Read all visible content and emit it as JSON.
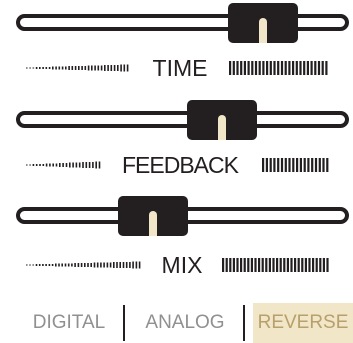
{
  "sliders": [
    {
      "id": "time",
      "label": "TIME",
      "level": 0.74
    },
    {
      "id": "feedback",
      "label": "FEEDBACK",
      "level": 0.62
    },
    {
      "id": "mix",
      "label": "MIX",
      "level": 0.41
    }
  ],
  "modes": [
    {
      "label": "DIGITAL",
      "active": false
    },
    {
      "label": "ANALOG",
      "active": false
    },
    {
      "label": "REVERSE",
      "active": true
    }
  ],
  "colors": {
    "ink": "#231f20",
    "thumb_indicator": "#f1e6c8",
    "active_mode_bg": "#f2e6c8",
    "active_mode_text": "#b7a06c",
    "inactive_mode_text": "#909090"
  }
}
